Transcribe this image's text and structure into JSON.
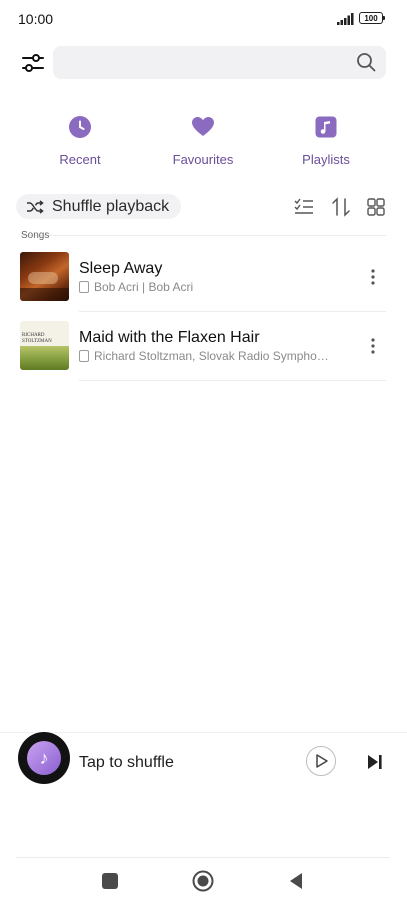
{
  "status_bar": {
    "time": "10:00",
    "battery": "100"
  },
  "search": {
    "placeholder": ""
  },
  "quick_nav": [
    {
      "label": "Recent",
      "icon": "clock-icon"
    },
    {
      "label": "Favourites",
      "icon": "heart-icon"
    },
    {
      "label": "Playlists",
      "icon": "music-note-icon"
    }
  ],
  "toolbar": {
    "shuffle_label": "Shuffle playback"
  },
  "section_label": "Songs",
  "songs": [
    {
      "title": "Sleep Away",
      "subtitle": "Bob Acri | Bob Acri"
    },
    {
      "title": "Maid with the Flaxen Hair",
      "subtitle": "Richard Stoltzman, Slovak Radio Sympho…",
      "cover_text_1": "RICHARD",
      "cover_text_2": "STOLTZMAN"
    }
  ],
  "mini_player": {
    "label": "Tap to shuffle"
  },
  "colors": {
    "accent": "#8a6bbf",
    "label": "#6b4d9a"
  }
}
